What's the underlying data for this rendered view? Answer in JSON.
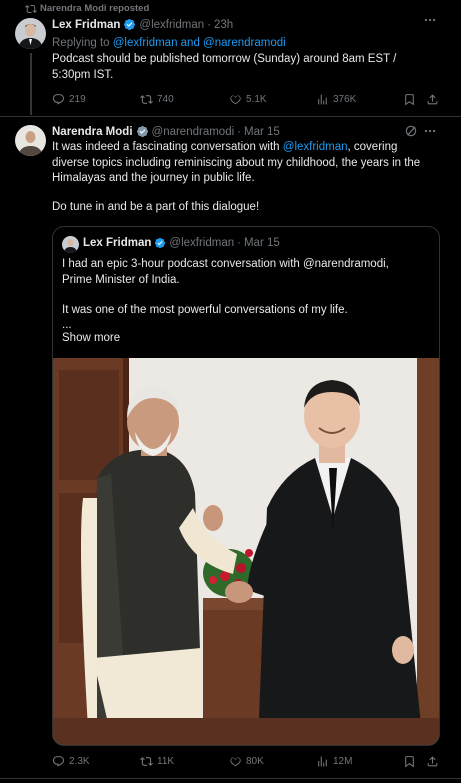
{
  "repost": {
    "label": "Narendra Modi reposted"
  },
  "tweet1": {
    "author_name": "Lex Fridman",
    "handle": "@lexfridman",
    "time": "23h",
    "replying_prefix": "Replying to",
    "replying_to": "@lexfridman and @narendramodi",
    "text": "Podcast should be published tomorrow (Sunday) around 8am EST / 5:30pm IST.",
    "replies": "219",
    "reposts": "740",
    "likes": "5.1K",
    "views": "376K"
  },
  "tweet2": {
    "author_name": "Narendra Modi",
    "handle": "@narendramodi",
    "time": "Mar 15",
    "text_before": "It was indeed a fascinating conversation with ",
    "mention": "@lexfridman",
    "text_after": ", covering diverse topics including reminiscing about my childhood, the years in the Himalayas and the journey in public life.",
    "text_2": "Do tune in and be a part of this dialogue!",
    "replies": "2.3K",
    "reposts": "11K",
    "likes": "80K",
    "views": "12M"
  },
  "quote": {
    "author_name": "Lex Fridman",
    "handle": "@lexfridman",
    "time": "Mar 15",
    "text_1": "I had an epic 3-hour podcast conversation with @narendramodi, Prime Minister of India.",
    "text_2": "It was one of the most powerful conversations of my life.",
    "text_3": "...",
    "show_more": "Show more"
  },
  "colors": {
    "accent": "#1d9bf0",
    "muted": "#71767b",
    "background": "#000000",
    "text": "#e7e9ea"
  },
  "icons": [
    "repost-icon",
    "verified-badge-icon",
    "more-icon",
    "reply-icon",
    "like-icon",
    "views-icon",
    "bookmark-icon",
    "share-icon",
    "grok-icon"
  ]
}
